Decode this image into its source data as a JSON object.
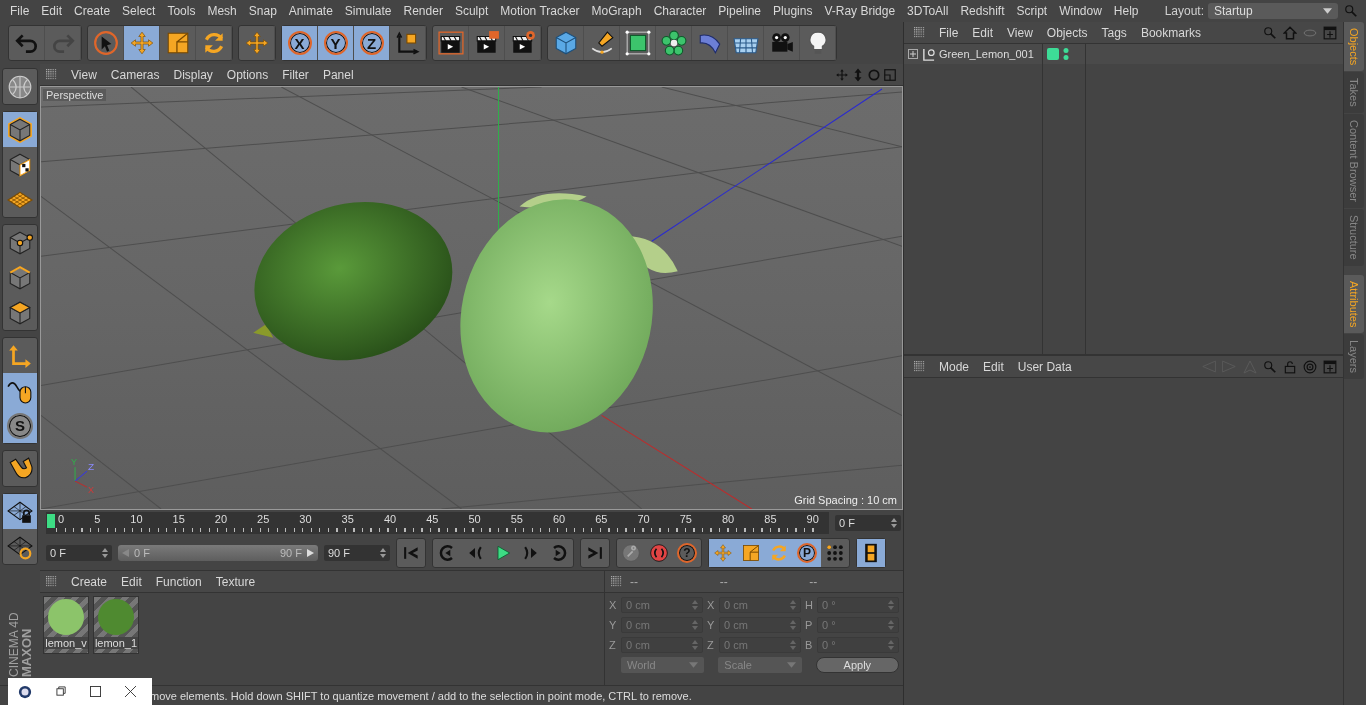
{
  "menubar": {
    "items": [
      "File",
      "Edit",
      "Create",
      "Select",
      "Tools",
      "Mesh",
      "Snap",
      "Animate",
      "Simulate",
      "Render",
      "Sculpt",
      "Motion Tracker",
      "MoGraph",
      "Character",
      "Pipeline",
      "Plugins",
      "V-Ray Bridge",
      "3DToAll",
      "Redshift",
      "Script",
      "Window",
      "Help"
    ],
    "layout_label": "Layout:",
    "layout_value": "Startup"
  },
  "toolbar": {
    "groups": [
      [
        {
          "kind": "undo",
          "selected": false,
          "disabled": false
        },
        {
          "kind": "redo",
          "selected": false,
          "disabled": true
        }
      ],
      [
        {
          "kind": "select",
          "selected": false,
          "disabled": false
        },
        {
          "kind": "move",
          "selected": true,
          "disabled": false
        },
        {
          "kind": "scale",
          "selected": false,
          "disabled": false
        },
        {
          "kind": "rotate",
          "selected": false,
          "disabled": false
        }
      ],
      [
        {
          "kind": "move",
          "selected": false,
          "disabled": false
        }
      ],
      [
        {
          "kind": "letter",
          "label": "X",
          "selected": true,
          "disabled": false
        },
        {
          "kind": "letter",
          "label": "Y",
          "selected": true,
          "disabled": false
        },
        {
          "kind": "letter",
          "label": "Z",
          "selected": true,
          "disabled": false
        },
        {
          "kind": "coord",
          "selected": false,
          "disabled": false
        }
      ],
      [
        {
          "kind": "renderview",
          "selected": false,
          "disabled": false
        },
        {
          "kind": "render",
          "selected": false,
          "disabled": false
        },
        {
          "kind": "rendersettings",
          "selected": false,
          "disabled": false
        }
      ],
      [
        {
          "kind": "cube",
          "selected": false,
          "disabled": false
        },
        {
          "kind": "pen",
          "selected": false,
          "disabled": false
        },
        {
          "kind": "subdiv",
          "selected": false,
          "disabled": false
        },
        {
          "kind": "cloner",
          "selected": false,
          "disabled": false
        },
        {
          "kind": "bend",
          "selected": false,
          "disabled": false
        },
        {
          "kind": "floor",
          "selected": false,
          "disabled": false
        },
        {
          "kind": "camera",
          "selected": false,
          "disabled": false
        },
        {
          "kind": "light",
          "selected": false,
          "disabled": false
        }
      ]
    ]
  },
  "left_tools": {
    "groups": [
      [
        {
          "kind": "globe",
          "selected": false
        }
      ],
      [
        {
          "kind": "model",
          "selected": true
        },
        {
          "kind": "texture",
          "selected": false
        },
        {
          "kind": "workplane",
          "selected": false
        }
      ],
      [
        {
          "kind": "points",
          "selected": false
        },
        {
          "kind": "edges",
          "selected": false
        },
        {
          "kind": "polygons",
          "selected": false
        }
      ],
      [
        {
          "kind": "axis",
          "selected": false
        },
        {
          "kind": "tweak",
          "selected": true
        },
        {
          "kind": "letter",
          "label": "S",
          "selected": true
        }
      ],
      [
        {
          "kind": "magnet",
          "selected": false
        }
      ],
      [
        {
          "kind": "gridlock",
          "selected": true
        },
        {
          "kind": "gridrefresh",
          "selected": false
        }
      ]
    ]
  },
  "logo": {
    "brand": "MAXON",
    "product": "CINEMA 4D"
  },
  "viewport": {
    "menus": [
      "View",
      "Cameras",
      "Display",
      "Options",
      "Filter",
      "Panel"
    ],
    "camera": "Perspective",
    "gizmo_labels": [
      "Y",
      "Z",
      "X"
    ],
    "grid_spacing": "Grid Spacing : 10 cm"
  },
  "timeline": {
    "labels": [
      "0",
      "5",
      "10",
      "15",
      "20",
      "25",
      "30",
      "35",
      "40",
      "45",
      "50",
      "55",
      "60",
      "65",
      "70",
      "75",
      "80",
      "85",
      "90"
    ],
    "current_frame": "0 F"
  },
  "transport": {
    "start": "0 F",
    "range": {
      "start": "0 F",
      "end": "90 F",
      "level": 1
    },
    "end": "90 F",
    "button_groups": [
      [
        {
          "kind": "gostart",
          "selected": false
        }
      ],
      [
        {
          "kind": "prevkey",
          "selected": false
        },
        {
          "kind": "prevframe",
          "selected": false
        },
        {
          "kind": "play",
          "selected": false
        },
        {
          "kind": "nextframe",
          "selected": false
        },
        {
          "kind": "nextkey",
          "selected": false
        }
      ],
      [
        {
          "kind": "goend",
          "selected": false
        }
      ],
      [
        {
          "kind": "keyframe",
          "selected": false
        },
        {
          "kind": "autokey",
          "selected": false
        },
        {
          "kind": "letter",
          "label": "?",
          "selected": false
        }
      ],
      [
        {
          "kind": "move",
          "selected": true
        },
        {
          "kind": "scale",
          "selected": true
        },
        {
          "kind": "rotate",
          "selected": true
        },
        {
          "kind": "letter",
          "label": "P",
          "selected": true
        },
        {
          "kind": "dots",
          "selected": false
        }
      ],
      [
        {
          "kind": "film",
          "selected": true
        }
      ]
    ]
  },
  "materials": {
    "menus": [
      "Create",
      "Edit",
      "Function",
      "Texture"
    ],
    "items": [
      {
        "name": "lemon_v",
        "color": "#8cc46a"
      },
      {
        "name": "lemon_1",
        "color": "#4f8a30"
      }
    ]
  },
  "coordinates": {
    "headers": [
      "--",
      "--",
      "--"
    ],
    "rows": [
      [
        {
          "label": "X",
          "value": "0 cm"
        },
        {
          "label": "X",
          "value": "0 cm"
        },
        {
          "label": "H",
          "value": "0 °"
        }
      ],
      [
        {
          "label": "Y",
          "value": "0 cm"
        },
        {
          "label": "Y",
          "value": "0 cm"
        },
        {
          "label": "P",
          "value": "0 °"
        }
      ],
      [
        {
          "label": "Z",
          "value": "0 cm"
        },
        {
          "label": "Z",
          "value": "0 cm"
        },
        {
          "label": "B",
          "value": "0 °"
        }
      ]
    ],
    "dropdowns": [
      "World",
      "Scale"
    ],
    "apply": "Apply"
  },
  "status_bar": "move elements. Hold down SHIFT to quantize movement / add to the selection in point mode, CTRL to remove.",
  "object_manager": {
    "menus": [
      "File",
      "Edit",
      "View",
      "Objects",
      "Tags",
      "Bookmarks"
    ],
    "objects": [
      {
        "name": "Green_Lemon_001",
        "expanded": false,
        "color": "#3ddc97"
      }
    ]
  },
  "attributes": {
    "menus": [
      "Mode",
      "Edit",
      "User Data"
    ]
  },
  "side_tabs": {
    "upper": [
      {
        "label": "Objects",
        "selected": true
      },
      {
        "label": "Takes",
        "selected": false
      },
      {
        "label": "Content Browser",
        "selected": false
      },
      {
        "label": "Structure",
        "selected": false
      }
    ],
    "lower": [
      {
        "label": "Attributes",
        "selected": true
      },
      {
        "label": "Layers",
        "selected": false
      }
    ]
  }
}
